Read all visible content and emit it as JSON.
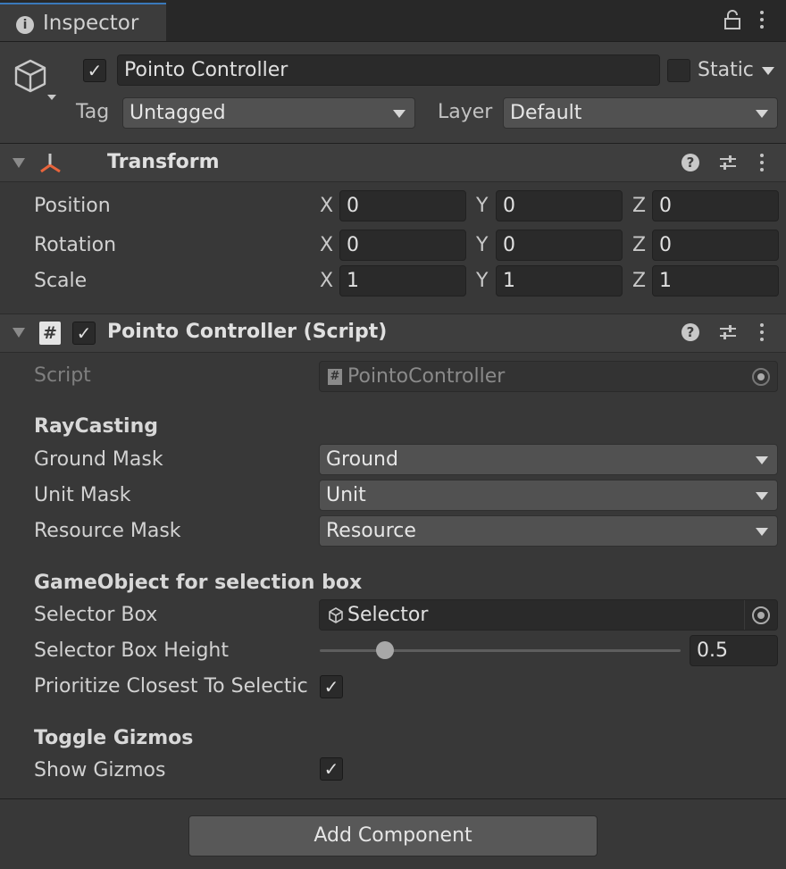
{
  "tab": {
    "title": "Inspector",
    "info_icon": "info-icon",
    "lock_icon": "lock-icon",
    "menu_icon": "kebab-menu-icon"
  },
  "gameobject": {
    "icon": "cube-icon",
    "active": true,
    "name": "Pointo Controller",
    "static_checked": false,
    "static_label": "Static",
    "tag_label": "Tag",
    "tag_value": "Untagged",
    "layer_label": "Layer",
    "layer_value": "Default"
  },
  "transform": {
    "title": "Transform",
    "rows": [
      {
        "label": "Position",
        "x": "0",
        "y": "0",
        "z": "0"
      },
      {
        "label": "Rotation",
        "x": "0",
        "y": "0",
        "z": "0"
      },
      {
        "label": "Scale",
        "x": "1",
        "y": "1",
        "z": "1"
      }
    ],
    "axis_x": "X",
    "axis_y": "Y",
    "axis_z": "Z"
  },
  "script_component": {
    "title": "Pointo Controller (Script)",
    "enabled": true,
    "script_label": "Script",
    "script_value": "PointoController",
    "raycasting_header": "RayCasting",
    "ground_mask_label": "Ground Mask",
    "ground_mask_value": "Ground",
    "unit_mask_label": "Unit Mask",
    "unit_mask_value": "Unit",
    "resource_mask_label": "Resource Mask",
    "resource_mask_value": "Resource",
    "selection_header": "GameObject for selection box",
    "selector_box_label": "Selector Box",
    "selector_box_value": "Selector",
    "selector_height_label": "Selector Box Height",
    "selector_height_value": "0.5",
    "selector_height_fraction": 0.18,
    "prioritize_label": "Prioritize Closest To Selectic",
    "prioritize_checked": true,
    "gizmos_header": "Toggle Gizmos",
    "show_gizmos_label": "Show Gizmos",
    "show_gizmos_checked": true
  },
  "footer": {
    "add_component_label": "Add Component"
  },
  "colors": {
    "accent": "#3a79bb",
    "panel": "#383838",
    "field": "#2a2a2a",
    "transform_icon": "#e8643c"
  }
}
